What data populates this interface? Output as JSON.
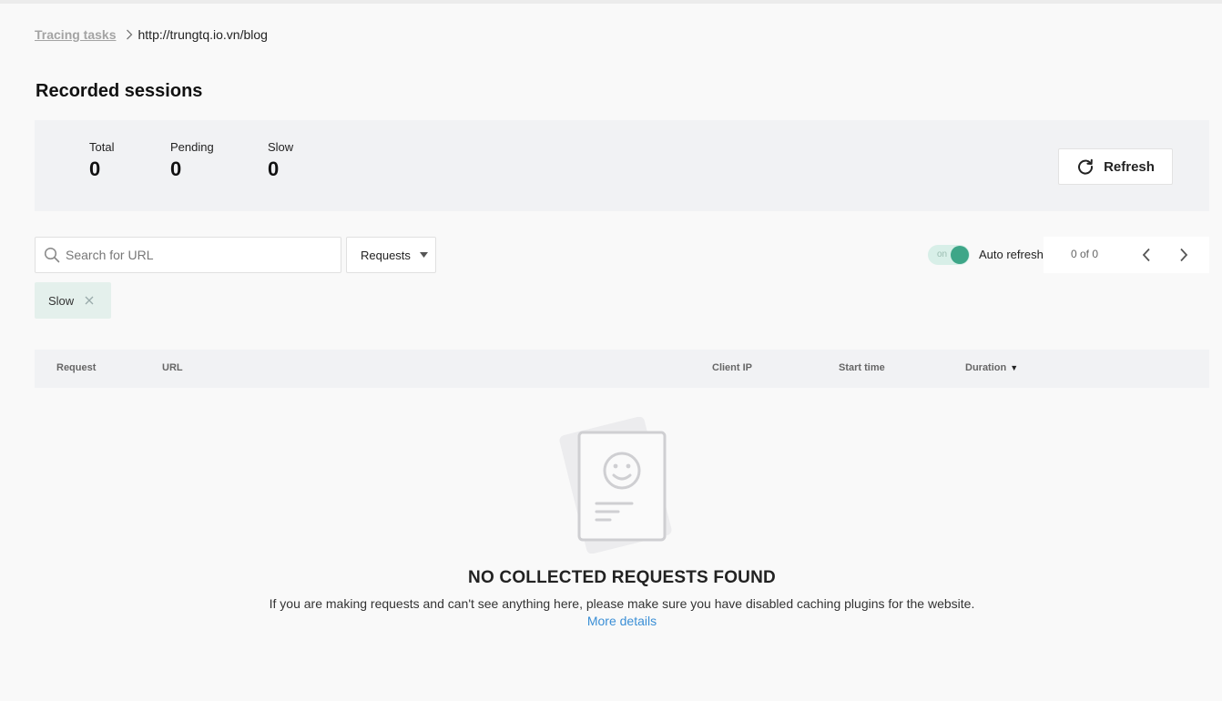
{
  "breadcrumb": {
    "parent": "Tracing tasks",
    "current": "http://trungtq.io.vn/blog"
  },
  "page": {
    "title": "Recorded sessions"
  },
  "stats": {
    "total_label": "Total",
    "total_value": "0",
    "pending_label": "Pending",
    "pending_value": "0",
    "slow_label": "Slow",
    "slow_value": "0"
  },
  "refresh": {
    "label": "Refresh",
    "icon": "refresh-icon"
  },
  "search": {
    "placeholder": "Search for URL",
    "value": ""
  },
  "filter_select": {
    "selected": "Requests"
  },
  "auto_refresh": {
    "toggle_text": "on",
    "label": "Auto refresh",
    "enabled": true
  },
  "pagination": {
    "text": "0 of 0"
  },
  "chips": [
    {
      "label": "Slow"
    }
  ],
  "table": {
    "columns": [
      "Request",
      "URL",
      "Client IP",
      "Start time",
      "Duration"
    ],
    "sort_indicator": "▼"
  },
  "empty_state": {
    "title": "NO COLLECTED REQUESTS FOUND",
    "description": "If you are making requests and can't see anything here, please make sure you have disabled caching plugins for the website.",
    "link": "More details"
  },
  "colors": {
    "accent": "#3ea688",
    "link": "#3b8fd6",
    "chip_bg": "#e4f0ec",
    "panel_bg": "#f1f2f4"
  }
}
